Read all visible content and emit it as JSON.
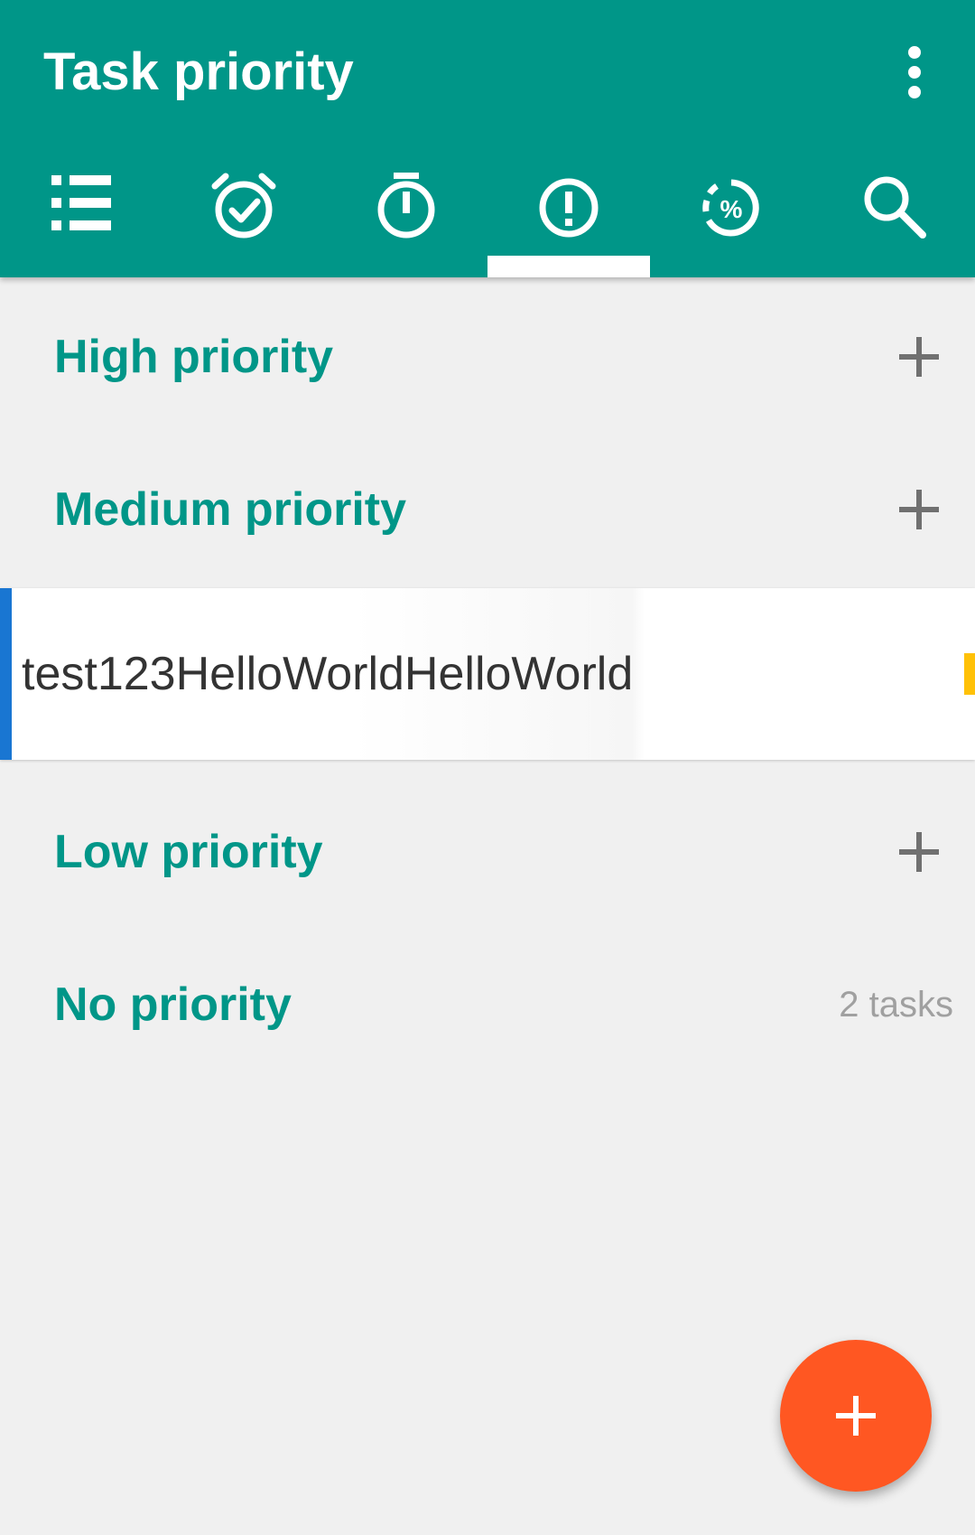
{
  "app": {
    "title": "Task priority",
    "accent_color": "#009688",
    "fab_color": "#ff5722"
  },
  "toolbar": {
    "overflow_icon": "more-vert-icon"
  },
  "tabs": [
    {
      "icon": "list-icon",
      "selected": false
    },
    {
      "icon": "alarm-check-icon",
      "selected": false
    },
    {
      "icon": "timer-icon",
      "selected": false
    },
    {
      "icon": "priority-icon",
      "selected": true
    },
    {
      "icon": "progress-percent-icon",
      "selected": false
    },
    {
      "icon": "search-icon",
      "selected": false
    }
  ],
  "sections": {
    "high": {
      "label": "High priority",
      "action_icon": "add-icon"
    },
    "medium": {
      "label": "Medium priority",
      "action_icon": "add-icon"
    },
    "low": {
      "label": "Low priority",
      "action_icon": "add-icon"
    },
    "none": {
      "label": "No priority",
      "count": "2 tasks"
    }
  },
  "tasks": [
    {
      "title": "test123HelloWorldHelloWorld",
      "list_color": "#1976d2",
      "flag_color": "#ffc107"
    }
  ],
  "fab": {
    "icon": "add-icon"
  }
}
